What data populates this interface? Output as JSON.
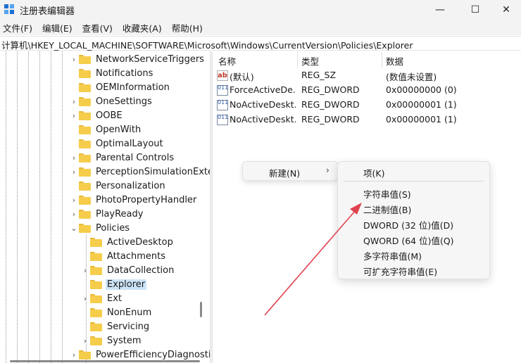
{
  "window": {
    "title": "注册表编辑器",
    "minimize_glyph": "—",
    "maximize_glyph": "☐",
    "close_glyph": "✕"
  },
  "menu": [
    "文件(F)",
    "编辑(E)",
    "查看(V)",
    "收藏夹(A)",
    "帮助(H)"
  ],
  "address": "计算机\\HKEY_LOCAL_MACHINE\\SOFTWARE\\Microsoft\\Windows\\CurrentVersion\\Policies\\Explorer",
  "tree": {
    "items": [
      {
        "label": "NetworkServiceTriggers",
        "expand": "›"
      },
      {
        "label": "Notifications",
        "expand": ""
      },
      {
        "label": "OEMInformation",
        "expand": ""
      },
      {
        "label": "OneSettings",
        "expand": "›"
      },
      {
        "label": "OOBE",
        "expand": "›"
      },
      {
        "label": "OpenWith",
        "expand": ""
      },
      {
        "label": "OptimalLayout",
        "expand": ""
      },
      {
        "label": "Parental Controls",
        "expand": "›"
      },
      {
        "label": "PerceptionSimulationExte",
        "expand": "›"
      },
      {
        "label": "Personalization",
        "expand": ""
      },
      {
        "label": "PhotoPropertyHandler",
        "expand": "›"
      },
      {
        "label": "PlayReady",
        "expand": "›"
      },
      {
        "label": "Policies",
        "expand": "⌄"
      },
      {
        "label": "ActiveDesktop",
        "expand": ""
      },
      {
        "label": "Attachments",
        "expand": ""
      },
      {
        "label": "DataCollection",
        "expand": "›"
      },
      {
        "label": "Explorer",
        "expand": ""
      },
      {
        "label": "Ext",
        "expand": "›"
      },
      {
        "label": "NonEnum",
        "expand": ""
      },
      {
        "label": "Servicing",
        "expand": ""
      },
      {
        "label": "System",
        "expand": "›"
      },
      {
        "label": "PowerEfficiencyDiagnostics",
        "expand": "›"
      }
    ]
  },
  "list": {
    "headers": {
      "name": "名称",
      "type": "类型",
      "data": "数据"
    },
    "rows": [
      {
        "name": "(默认)",
        "type": "REG_SZ",
        "data": "(数值未设置)",
        "icon": "ab"
      },
      {
        "name": "ForceActiveDe...",
        "type": "REG_DWORD",
        "data": "0x00000000 (0)",
        "icon": "011"
      },
      {
        "name": "NoActiveDeskt...",
        "type": "REG_DWORD",
        "data": "0x00000001 (1)",
        "icon": "011"
      },
      {
        "name": "NoActiveDeskt...",
        "type": "REG_DWORD",
        "data": "0x00000001 (1)",
        "icon": "011"
      }
    ]
  },
  "context_menu": {
    "new_label": "新建(N)",
    "arrow": "›",
    "submenu": {
      "key": "项(K)",
      "string": "字符串值(S)",
      "binary": "二进制值(B)",
      "dword": "DWORD (32 位)值(D)",
      "qword": "QWORD (64 位)值(Q)",
      "multi": "多字符串值(M)",
      "expand": "可扩充字符串值(E)"
    }
  },
  "colors": {
    "selection": "#cce4f7",
    "annotation_arrow": "#e0434f",
    "folder": "#f6cd4b"
  }
}
